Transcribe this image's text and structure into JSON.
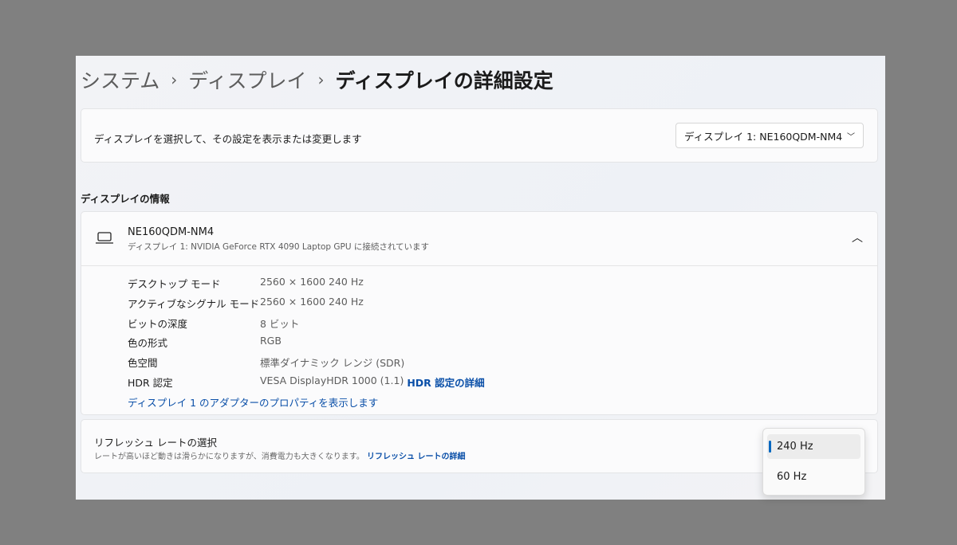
{
  "breadcrumb": [
    "システム",
    "ディスプレイ",
    "ディスプレイの詳細設定"
  ],
  "select_card": {
    "label": "ディスプレイを選択して、その設定を表示または変更します",
    "selected": "ディスプレイ 1: NE160QDM-NM4"
  },
  "section_title": "ディスプレイの情報",
  "display": {
    "name": "NE160QDM-NM4",
    "subtitle": "ディスプレイ 1: NVIDIA GeForce RTX 4090 Laptop GPU に接続されています",
    "rows": [
      {
        "k": "デスクトップ モード",
        "v": "2560 × 1600 240 Hz"
      },
      {
        "k": "アクティブなシグナル モード",
        "v": "2560 × 1600 240 Hz"
      },
      {
        "k": "ビットの深度",
        "v": "8 ビット"
      },
      {
        "k": "色の形式",
        "v": "RGB"
      },
      {
        "k": "色空間",
        "v": "標準ダイナミック レンジ (SDR)"
      },
      {
        "k": "HDR 認定",
        "v": "VESA DisplayHDR 1000 (1.1)"
      }
    ],
    "hdr_link": "HDR 認定の詳細",
    "adapter_link": "ディスプレイ 1 のアダプターのプロパティを表示します"
  },
  "refresh": {
    "title": "リフレッシュ レートの選択",
    "desc": "レートが高いほど動きは滑らかになりますが、消費電力も大きくなります。",
    "link": "リフレッシュ レートの詳細",
    "options": [
      "240 Hz",
      "60 Hz"
    ]
  },
  "accent": "#0067c0"
}
